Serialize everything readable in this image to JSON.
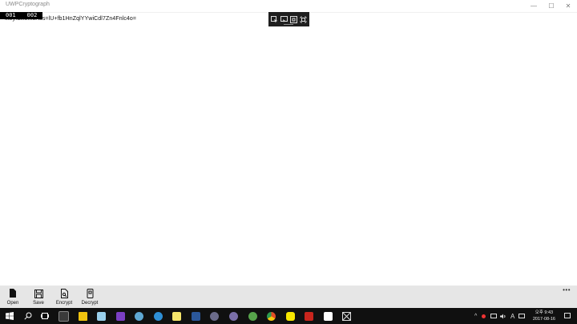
{
  "window": {
    "title": "UWPCryptograph",
    "controls": {
      "minimize": "—",
      "maximize": "☐",
      "close": "✕"
    }
  },
  "debug": {
    "frame_counters": [
      "001",
      "002"
    ]
  },
  "editor": {
    "text": "fkeyfdlkemeAss=lU+fb1HnZqlYYwiCdl7Zn4Fnlc4o="
  },
  "xaml_toolbar": {
    "icons": [
      "select-element-icon",
      "display-adorners-icon",
      "track-focus-icon",
      "layout-adorners-icon"
    ]
  },
  "command_bar": {
    "buttons": [
      {
        "label": "Open",
        "icon": "open-file-icon"
      },
      {
        "label": "Save",
        "icon": "save-icon"
      },
      {
        "label": "Encrypt",
        "icon": "encrypt-icon"
      },
      {
        "label": "Decrypt",
        "icon": "decrypt-icon"
      }
    ],
    "more": "•••"
  },
  "taskbar": {
    "time_period": "오후",
    "time": "9:43",
    "date": "2017-08-16",
    "ime": "A",
    "colors": {
      "explorer": "#f1c40f",
      "visual_studio": "#7b3fc4",
      "kakao": "#f7e600",
      "filezilla": "#c8251d",
      "chrome": "#e44d26"
    }
  }
}
